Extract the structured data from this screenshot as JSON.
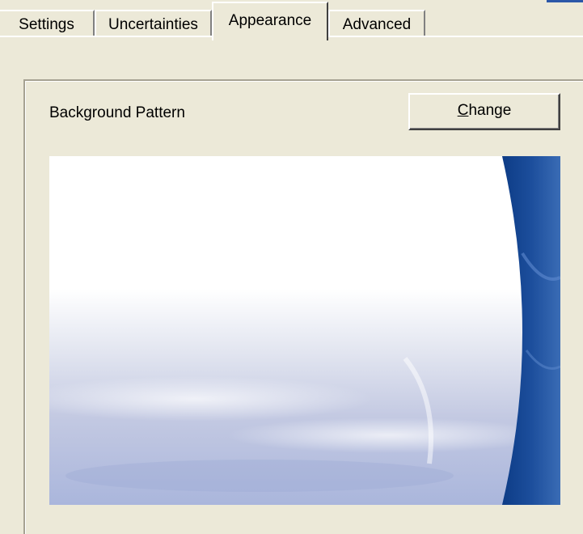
{
  "tabs": [
    {
      "label": "Settings"
    },
    {
      "label": "Uncertainties"
    },
    {
      "label": "Appearance",
      "selected": true
    },
    {
      "label": "Advanced"
    }
  ],
  "background_group": {
    "label": "Background Pattern",
    "change_button": {
      "accel": "C",
      "rest": "hange"
    }
  },
  "preview": {
    "colors": {
      "light": "#c9cfe4",
      "mid": "#9aa9d3",
      "dark": "#1c4e9c",
      "deep": "#0d3c86"
    }
  }
}
